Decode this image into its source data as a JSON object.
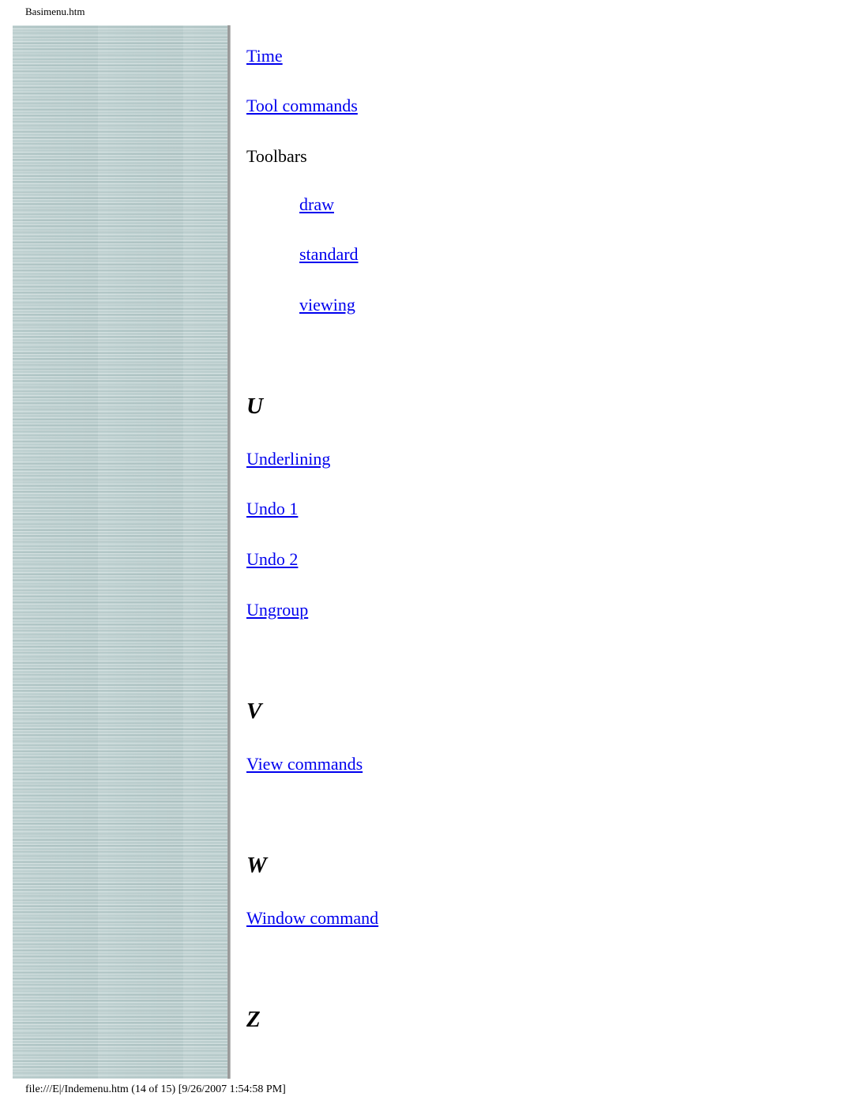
{
  "header": {
    "title": "Basimenu.htm"
  },
  "index": {
    "t_items": [
      {
        "label": "Time"
      },
      {
        "label": "Tool commands"
      }
    ],
    "toolbars": {
      "label": "Toolbars",
      "sub_items": [
        {
          "label": "draw"
        },
        {
          "label": "standard"
        },
        {
          "label": "viewing"
        }
      ]
    },
    "sections": [
      {
        "letter": "U",
        "items": [
          {
            "label": "Underlining"
          },
          {
            "label": "Undo 1"
          },
          {
            "label": "Undo 2"
          },
          {
            "label": "Ungroup"
          }
        ]
      },
      {
        "letter": "V",
        "items": [
          {
            "label": "View commands"
          }
        ]
      },
      {
        "letter": "W",
        "items": [
          {
            "label": "Window command"
          }
        ]
      },
      {
        "letter": "Z",
        "items": []
      }
    ]
  },
  "footer": {
    "text": "file:///E|/Indemenu.htm (14 of 15) [9/26/2007 1:54:58 PM]"
  },
  "colors": {
    "link": "#0000ee",
    "sidebar": "#bccfcf"
  }
}
